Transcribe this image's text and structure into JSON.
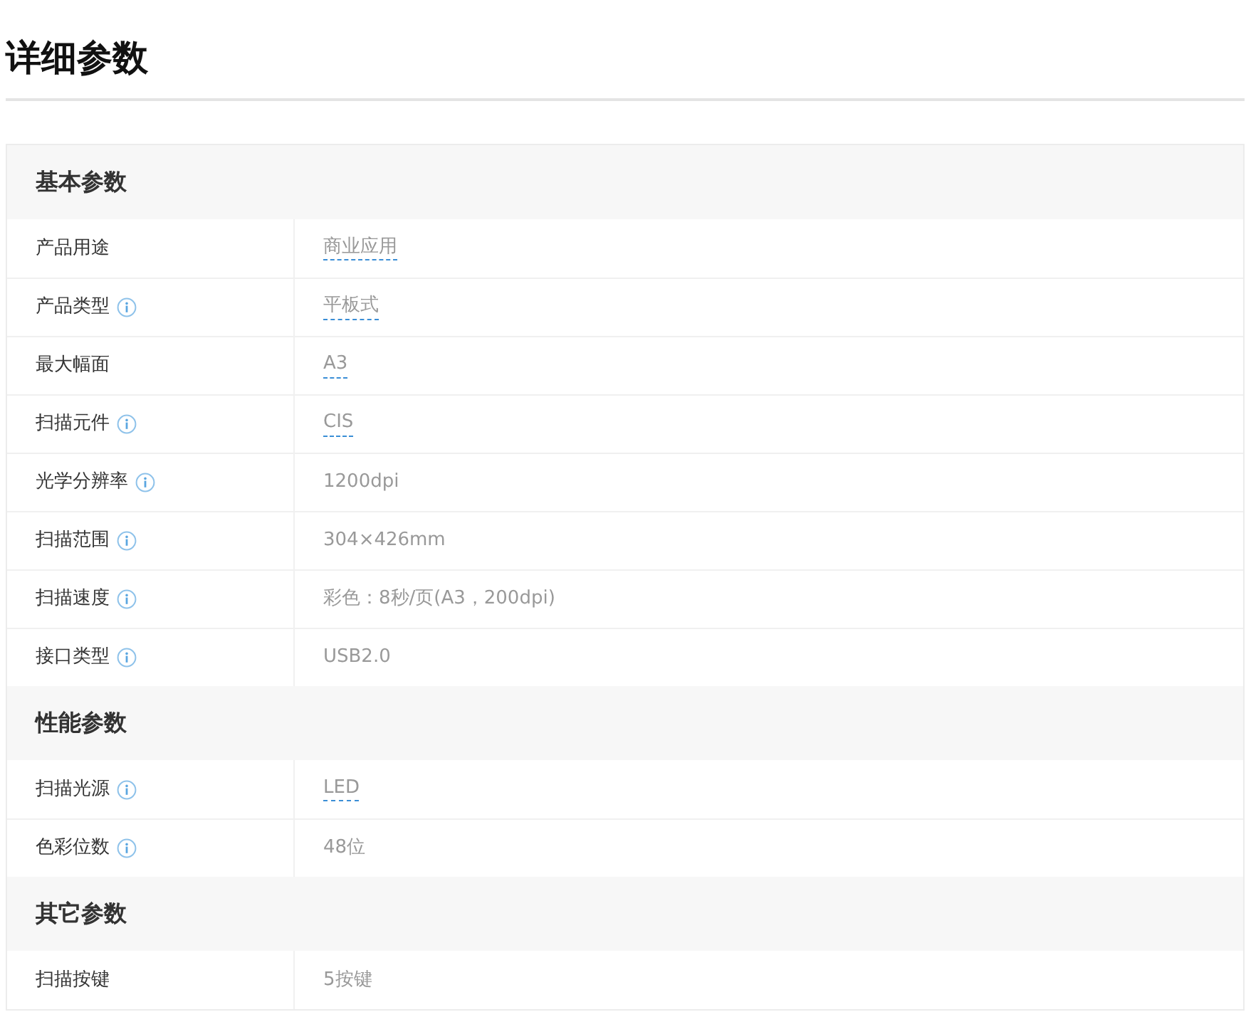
{
  "title": "详细参数",
  "sections": [
    {
      "heading": "基本参数",
      "rows": [
        {
          "label": "产品用途",
          "info": false,
          "value": "商业应用",
          "link": true
        },
        {
          "label": "产品类型",
          "info": true,
          "value": "平板式",
          "link": true
        },
        {
          "label": "最大幅面",
          "info": false,
          "value": "A3",
          "link": true
        },
        {
          "label": "扫描元件",
          "info": true,
          "value": "CIS",
          "link": true
        },
        {
          "label": "光学分辨率",
          "info": true,
          "value": "1200dpi",
          "link": false
        },
        {
          "label": "扫描范围",
          "info": true,
          "value": "304×426mm",
          "link": false
        },
        {
          "label": "扫描速度",
          "info": true,
          "value": "彩色：8秒/页(A3，200dpi)",
          "link": false
        },
        {
          "label": "接口类型",
          "info": true,
          "value": "USB2.0",
          "link": false
        }
      ]
    },
    {
      "heading": "性能参数",
      "rows": [
        {
          "label": "扫描光源",
          "info": true,
          "value": "LED",
          "link": true
        },
        {
          "label": "色彩位数",
          "info": true,
          "value": "48位",
          "link": false
        }
      ]
    },
    {
      "heading": "其它参数",
      "rows": [
        {
          "label": "扫描按键",
          "info": false,
          "value": "5按键",
          "link": false
        }
      ]
    }
  ]
}
